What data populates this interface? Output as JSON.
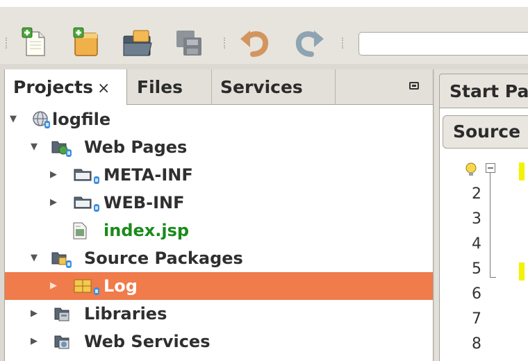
{
  "toolbar": {
    "buttons": [
      {
        "name": "new-file-icon"
      },
      {
        "name": "new-project-icon"
      },
      {
        "name": "open-project-icon"
      },
      {
        "name": "save-all-icon"
      },
      {
        "name": "undo-icon"
      },
      {
        "name": "redo-icon"
      }
    ],
    "search_value": ""
  },
  "projects_panel": {
    "tabs": [
      {
        "label": "Projects",
        "close": "×",
        "active": true
      },
      {
        "label": "Files",
        "active": false
      },
      {
        "label": "Services",
        "active": false
      }
    ],
    "tree": [
      {
        "label": "logfile",
        "expanded": true,
        "icon": "web-project-icon",
        "depth": 0
      },
      {
        "label": "Web Pages",
        "expanded": true,
        "icon": "web-pages-folder-icon",
        "depth": 1
      },
      {
        "label": "META-INF",
        "expanded": false,
        "icon": "folder-icon",
        "depth": 2
      },
      {
        "label": "WEB-INF",
        "expanded": false,
        "icon": "folder-icon",
        "depth": 2
      },
      {
        "label": "index.jsp",
        "icon": "jsp-file-icon",
        "depth": 2,
        "color": "#1a8a1a"
      },
      {
        "label": "Source Packages",
        "expanded": true,
        "icon": "source-packages-icon",
        "depth": 1
      },
      {
        "label": "Log",
        "expanded": false,
        "icon": "package-icon",
        "depth": 2,
        "selected": true
      },
      {
        "label": "Libraries",
        "expanded": false,
        "icon": "libraries-icon",
        "depth": 1
      },
      {
        "label": "Web Services",
        "expanded": false,
        "icon": "web-services-icon",
        "depth": 1
      }
    ]
  },
  "editor": {
    "tab_label": "Start Pa",
    "source_button": "Source",
    "line_numbers": [
      "2",
      "3",
      "4",
      "5",
      "6",
      "7",
      "8"
    ]
  },
  "colors": {
    "selection": "#f07b4b",
    "jsp_text": "#1a8a1a",
    "highlight": "#f3f200"
  }
}
